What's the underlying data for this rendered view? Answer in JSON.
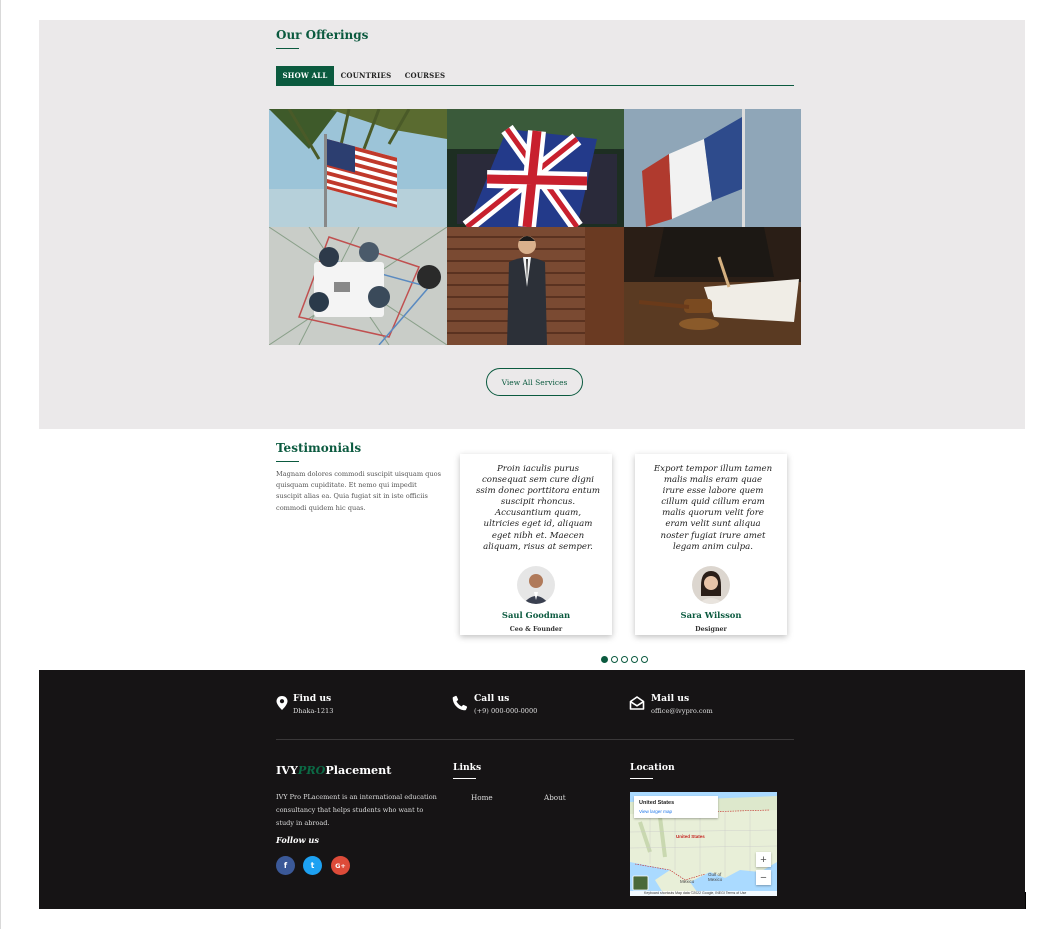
{
  "offerings": {
    "title": "Our Offerings",
    "tabs": [
      {
        "label": "SHOW ALL",
        "active": true
      },
      {
        "label": "COUNTRIES",
        "active": false
      },
      {
        "label": "COURSES",
        "active": false
      }
    ],
    "gallery_icons": [
      "usa-flag-image",
      "uk-flag-image",
      "france-flag-image",
      "team-meeting-image",
      "businessman-image",
      "law-gavel-image"
    ],
    "view_all_label": "View All Services"
  },
  "testimonials": {
    "title": "Testimonials",
    "intro": "Magnam dolores commodi suscipit uisquam quos quisquam cupiditate. Et nemo qui impedit suscipit alias ea. Quia fugiat sit in iste officiis commodi quidem hic quas.",
    "cards": [
      {
        "quote_lines": [
          "Proin iaculis purus",
          "consequat sem cure digni",
          "ssim donec porttitora entum",
          "suscipit rhoncus.",
          "Accusantium quam,",
          "ultricies eget id, aliquam",
          "eget nibh et. Maecen",
          "aliquam, risus at semper."
        ],
        "name": "Saul Goodman",
        "role": "Ceo & Founder"
      },
      {
        "quote_lines": [
          "Export tempor illum tamen",
          "malis malis eram quae",
          "irure esse labore quem",
          "cillum quid cillum eram",
          "malis quorum velit fore",
          "eram velit sunt aliqua",
          "noster fugiat irure amet",
          "legam anim culpa."
        ],
        "name": "Sara Wilsson",
        "role": "Designer"
      }
    ],
    "carousel_dots": 5,
    "active_dot": 0
  },
  "footer": {
    "contacts": [
      {
        "icon": "map-pin-icon",
        "title": "Find us",
        "value": "Dhaka-1213"
      },
      {
        "icon": "phone-icon",
        "title": "Call us",
        "value": "(+9) 000-000-0000"
      },
      {
        "icon": "envelope-open-icon",
        "title": "Mail us",
        "value": "office@ivypro.com"
      }
    ],
    "brand": {
      "part1": "IVY",
      "part2": "PRO",
      "part3": "Placement"
    },
    "about": "IVY Pro PLacement is an international education consultancy that helps students who want to study in abroad.",
    "follow_label": "Follow us",
    "social": [
      {
        "icon": "facebook-icon",
        "glyph": "f",
        "color": "#3b5998"
      },
      {
        "icon": "twitter-icon",
        "glyph": "t",
        "color": "#1da1f2"
      },
      {
        "icon": "google-plus-icon",
        "glyph": "G+",
        "color": "#dd4b39"
      }
    ],
    "links_title": "Links",
    "links": [
      "Home",
      "About"
    ],
    "location_title": "Location",
    "map": {
      "place": "United States",
      "view_larger": "View larger map",
      "country_label": "United States",
      "mexico_label": "Mexico",
      "gulf_label": "Gulf of Mexico",
      "footer_text": "Keyboard shortcuts   Map data ©2022 Google, INEGI   Terms of Use",
      "zoom_in": "+",
      "zoom_out": "−"
    }
  }
}
